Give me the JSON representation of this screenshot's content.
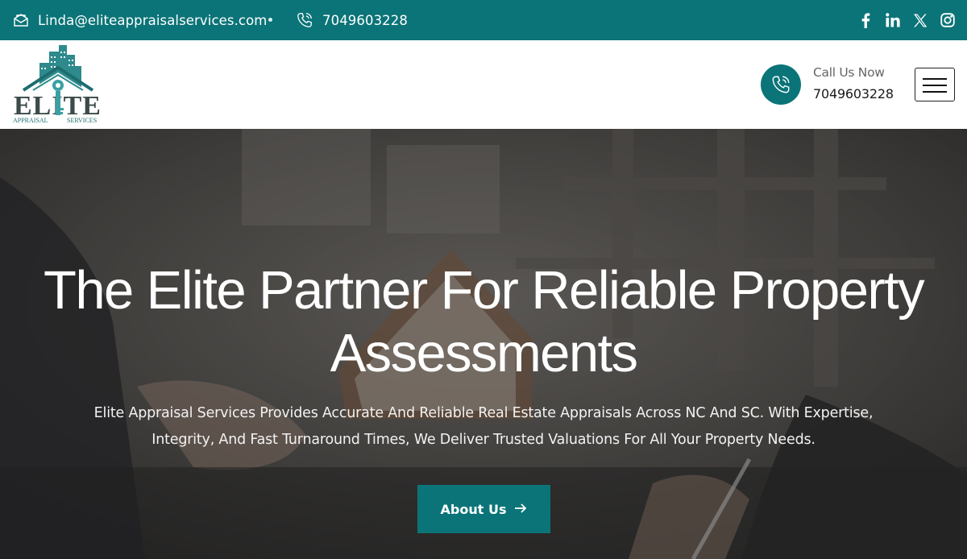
{
  "topbar": {
    "email": "Linda@eliteappraisalservices.com",
    "phone": "7049603228",
    "email_icon": "envelope-icon",
    "phone_icon": "phone-icon",
    "social": [
      "facebook-icon",
      "linkedin-icon",
      "x-twitter-icon",
      "instagram-icon"
    ],
    "bg_color": "#0b7478"
  },
  "header": {
    "logo": {
      "brand": "ELITE",
      "tagline_left": "APPRAISAL",
      "tagline_right": "SERVICES"
    },
    "call_label": "Call Us Now",
    "call_number": "7049603228",
    "menu_icon": "hamburger-menu-icon"
  },
  "hero": {
    "title_line1": "The Elite Partner For Reliable Property",
    "title_line2": "Assessments",
    "subtitle_line1": "Elite Appraisal Services Provides Accurate And Reliable Real Estate Appraisals Across NC And SC. With Expertise,",
    "subtitle_line2": "Integrity, And Fast Turnaround Times, We Deliver Trusted Valuations For All Your Property Needs.",
    "button_label": "About Us",
    "button_icon": "arrow-right-icon",
    "accent_color": "#0b7478"
  }
}
